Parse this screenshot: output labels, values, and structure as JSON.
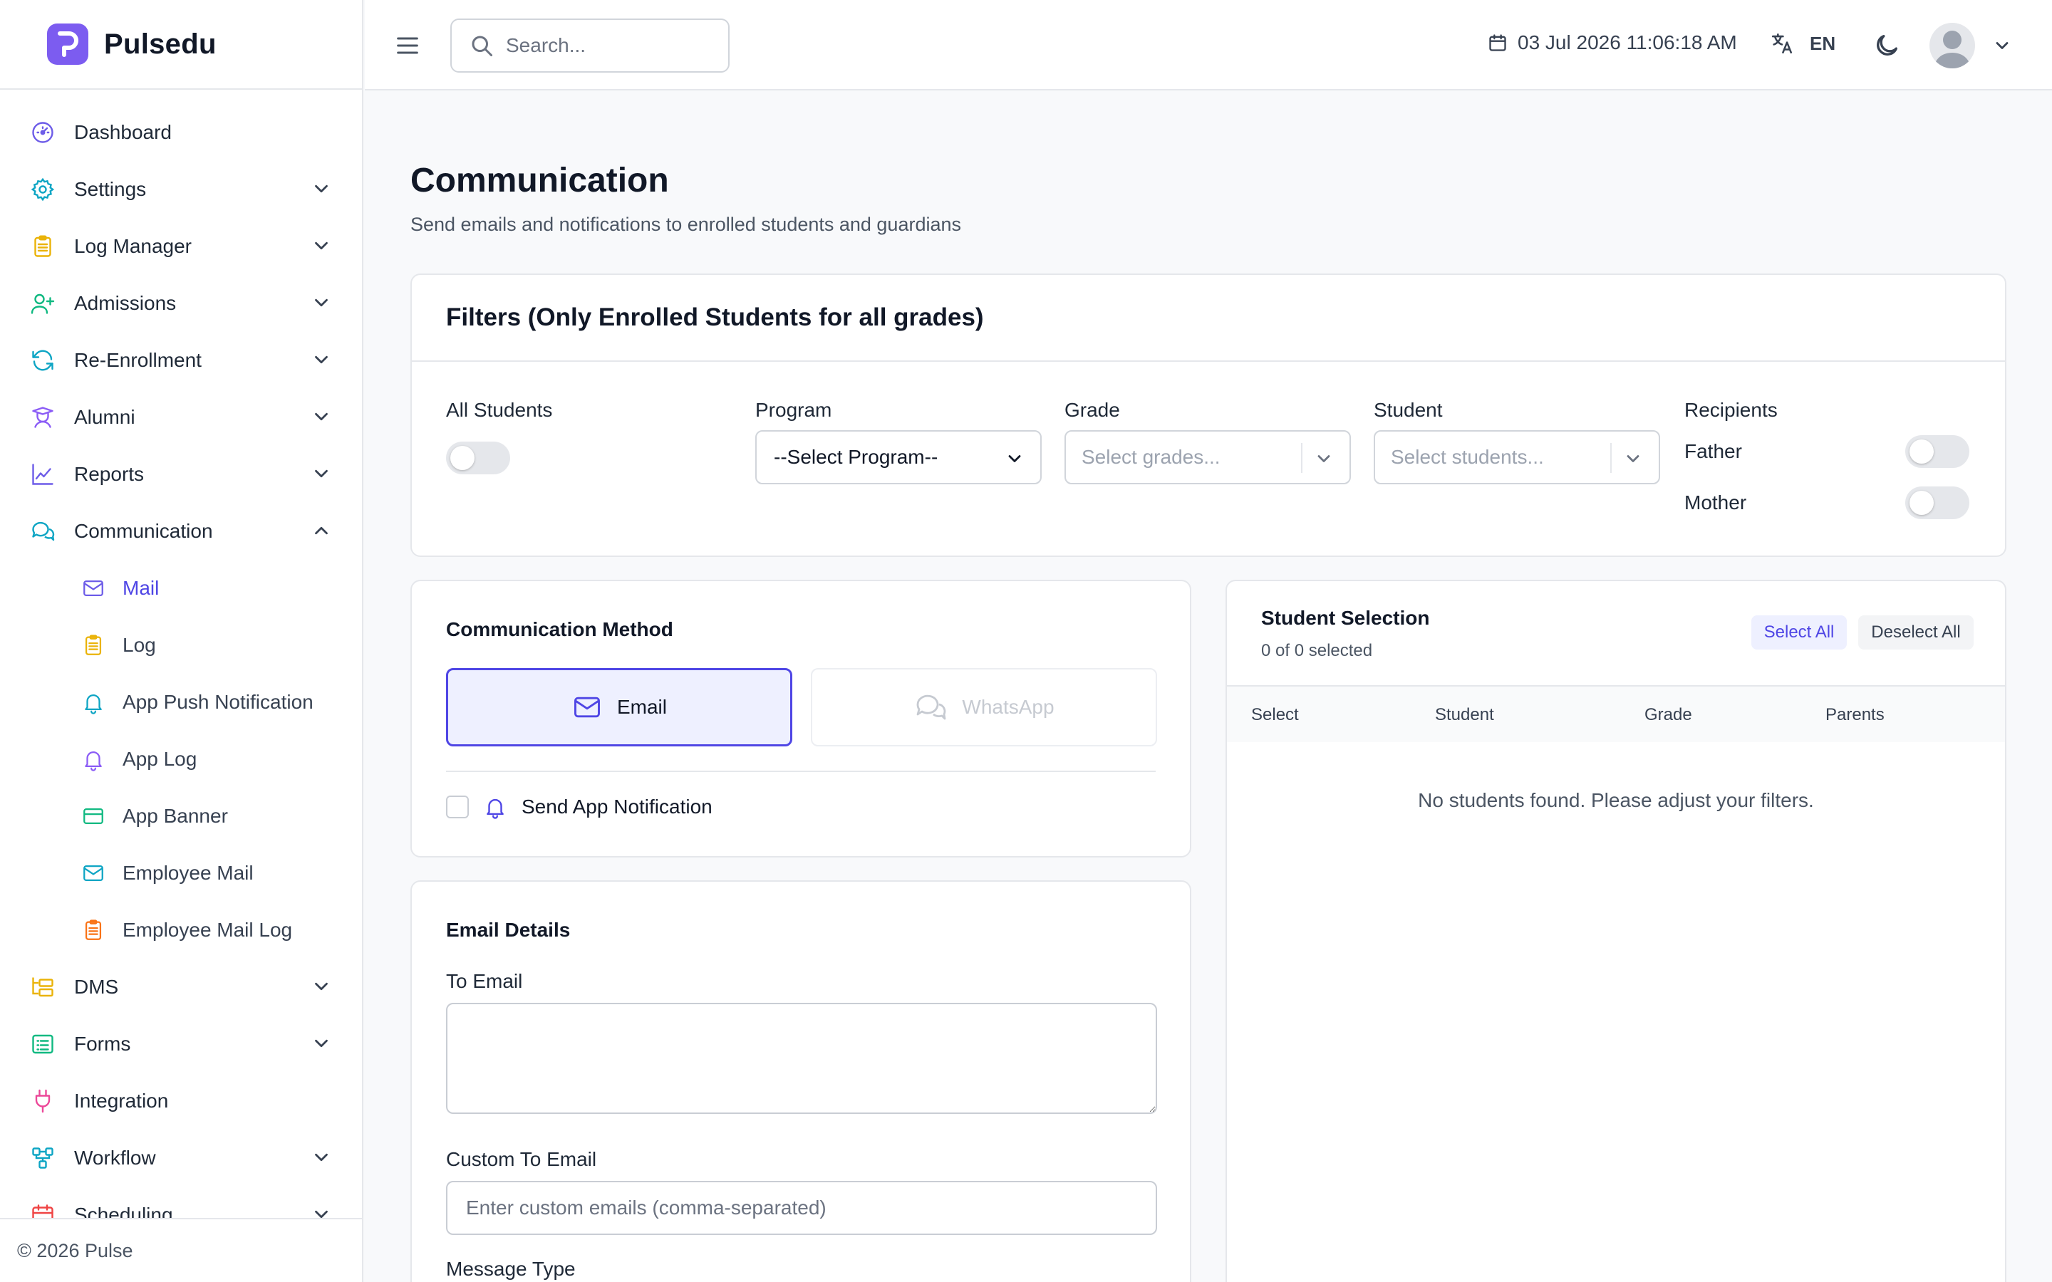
{
  "brand": {
    "name": "Pulsedu"
  },
  "sidebar": {
    "items": [
      {
        "label": "Dashboard"
      },
      {
        "label": "Settings"
      },
      {
        "label": "Log Manager"
      },
      {
        "label": "Admissions"
      },
      {
        "label": "Re-Enrollment"
      },
      {
        "label": "Alumni"
      },
      {
        "label": "Reports"
      },
      {
        "label": "Communication"
      },
      {
        "label": "DMS"
      },
      {
        "label": "Forms"
      },
      {
        "label": "Integration"
      },
      {
        "label": "Workflow"
      },
      {
        "label": "Scheduling"
      }
    ],
    "communication_sub": [
      {
        "label": "Mail"
      },
      {
        "label": "Log"
      },
      {
        "label": "App Push Notification"
      },
      {
        "label": "App Log"
      },
      {
        "label": "App Banner"
      },
      {
        "label": "Employee Mail"
      },
      {
        "label": "Employee Mail Log"
      }
    ],
    "footer": "© 2026 Pulse"
  },
  "topbar": {
    "search_placeholder": "Search...",
    "datetime": "03 Jul 2026 11:06:18 AM",
    "language": "EN"
  },
  "page": {
    "title": "Communication",
    "subtitle": "Send emails and notifications to enrolled students and guardians"
  },
  "filters": {
    "title": "Filters (Only Enrolled Students for all grades)",
    "all_students_label": "All Students",
    "program_label": "Program",
    "program_value": "--Select Program--",
    "grade_label": "Grade",
    "grade_placeholder": "Select grades...",
    "student_label": "Student",
    "student_placeholder": "Select students...",
    "recipients_label": "Recipients",
    "recipient_father": "Father",
    "recipient_mother": "Mother"
  },
  "method": {
    "title": "Communication Method",
    "email": "Email",
    "whatsapp": "WhatsApp",
    "send_app_notification": "Send App Notification"
  },
  "email_details": {
    "title": "Email Details",
    "to_email_label": "To Email",
    "custom_to_email_label": "Custom To Email",
    "custom_to_email_placeholder": "Enter custom emails (comma-separated)",
    "message_type_label": "Message Type"
  },
  "selection": {
    "title": "Student Selection",
    "count": "0 of 0 selected",
    "select_all": "Select All",
    "deselect_all": "Deselect All",
    "columns": [
      "Select",
      "Student",
      "Grade",
      "Parents"
    ],
    "empty": "No students found. Please adjust your filters."
  },
  "colors": {
    "accent": "#4f46e5",
    "brand": "#7c5cf0",
    "toggle_off": "#e5e7eb"
  }
}
